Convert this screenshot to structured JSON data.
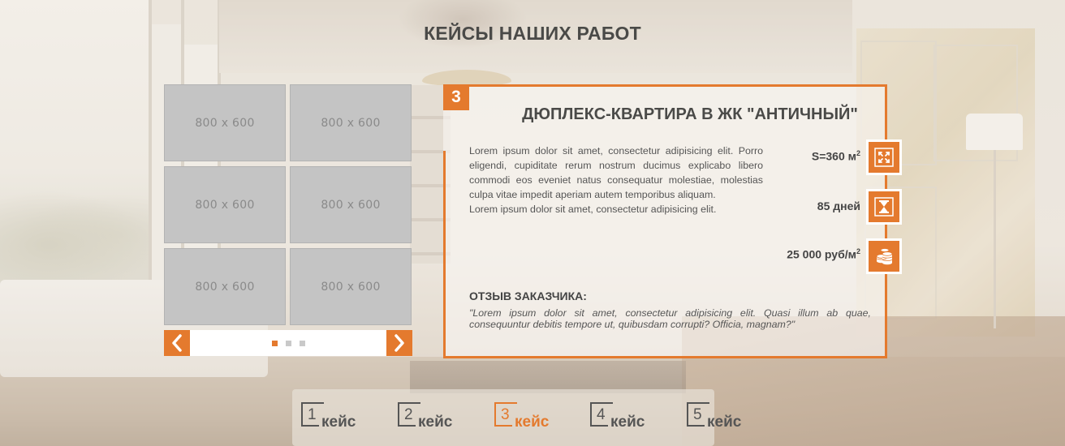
{
  "page": {
    "title": "КЕЙСЫ НАШИХ РАБОТ"
  },
  "gallery": {
    "thumbnails": [
      "800 x 600",
      "800 x 600",
      "800 x 600",
      "800 x 600",
      "800 x 600",
      "800 x 600"
    ],
    "active_dot": 1,
    "dot_count": 3,
    "prev_icon": "chevron-left-icon",
    "next_icon": "chevron-right-icon"
  },
  "case": {
    "number": "3",
    "title": "ДЮПЛЕКС-КВАРТИРА В ЖК \"АНТИЧНЫЙ\"",
    "description_1": "Lorem ipsum dolor sit amet, consectetur adipisicing elit. Porro eligendi, cupiditate rerum nostrum ducimus explicabo libero commodi eos eveniet natus consequatur molestiae, molestias culpa vitae impedit aperiam autem temporibus aliquam.",
    "description_2": "Lorem ipsum dolor sit amet, consectetur adipisicing elit.",
    "stats": {
      "area": {
        "text": "S=360 м",
        "sup": "2",
        "icon": "expand-arrows-icon"
      },
      "duration": {
        "text": "85 дней",
        "icon": "hourglass-icon"
      },
      "price": {
        "text": "25 000 руб/м",
        "sup": "2",
        "icon": "coins-icon"
      }
    },
    "review_heading": "ОТЗЫВ ЗАКАЗЧИКА:",
    "review_text": "\"Lorem ipsum dolor sit amet, consectetur adipisicing elit. Quasi illum ab quae, consequuntur debitis tempore ut, quibusdam corrupti? Officia, magnam?\""
  },
  "case_tabs": [
    {
      "num": "1",
      "word": "кейс"
    },
    {
      "num": "2",
      "word": "кейс"
    },
    {
      "num": "3",
      "word": "кейс"
    },
    {
      "num": "4",
      "word": "кейс"
    },
    {
      "num": "5",
      "word": "кейс"
    }
  ],
  "active_case_index": 2,
  "colors": {
    "accent": "#e47a2e",
    "text": "#4a4a48",
    "thumb": "#c4c4c4"
  }
}
